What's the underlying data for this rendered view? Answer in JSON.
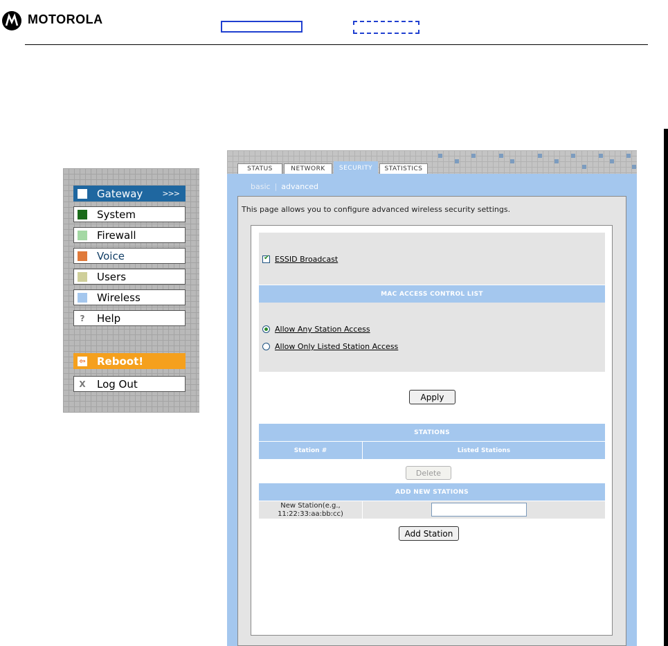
{
  "header": {
    "brand": "MOTOROLA"
  },
  "nav": {
    "items": [
      {
        "label": "Gateway",
        "color": "#ffffff",
        "arrow": ">>>"
      },
      {
        "label": "System",
        "color": "#1a6b1a"
      },
      {
        "label": "Firewall",
        "color": "#a4d8a4"
      },
      {
        "label": "Voice",
        "color": "#e07a3a"
      },
      {
        "label": "Users",
        "color": "#cfcf9a"
      },
      {
        "label": "Wireless",
        "color": "#a4c7ee"
      },
      {
        "label": "Help",
        "glyph": "?"
      }
    ],
    "reboot": {
      "label": "Reboot!",
      "glyph": "⇦"
    },
    "logout": {
      "label": "Log Out",
      "glyph": "X"
    }
  },
  "tabs": [
    "STATUS",
    "NETWORK",
    "SECURITY",
    "STATISTICS"
  ],
  "active_tab": "SECURITY",
  "subnav": {
    "basic": "basic",
    "advanced": "advanced"
  },
  "intro": "This page allows you to configure advanced wireless security settings.",
  "essid": {
    "label": "ESSID Broadcast",
    "checked": true
  },
  "mac_acl": {
    "title": "MAC ACCESS CONTROL LIST",
    "option_any": "Allow Any Station Access",
    "option_listed": "Allow Only Listed Station Access",
    "selected": "any"
  },
  "apply_button": "Apply",
  "stations": {
    "title": "STATIONS",
    "col_num": "Station #",
    "col_listed": "Listed Stations",
    "delete_button": "Delete"
  },
  "add_new": {
    "title": "ADD NEW STATIONS",
    "label_line1": "New Station(e.g.,",
    "label_line2": "11:22:33:aa:bb:cc)",
    "input_value": "",
    "add_button": "Add Station"
  },
  "colors": {
    "panel_blue": "#a4c7ee",
    "active_nav": "#1f67a0",
    "reboot": "#f5a01d"
  }
}
